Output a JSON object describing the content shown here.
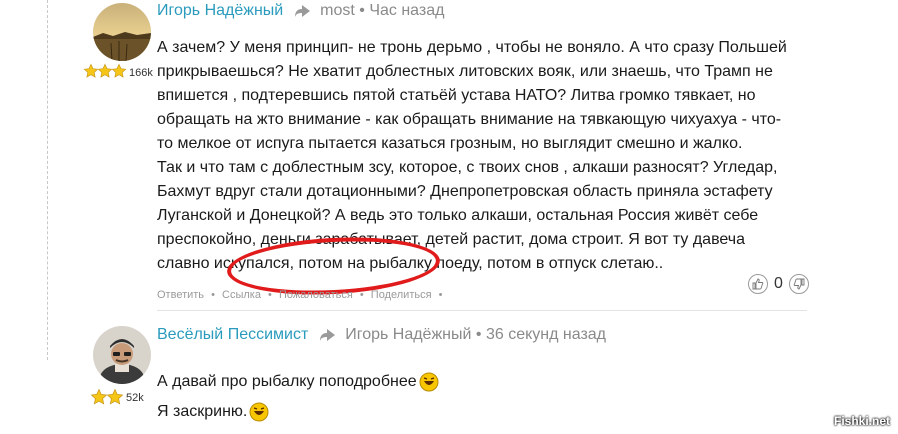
{
  "comments": [
    {
      "author": "Игорь Надёжный",
      "reply_to": "most",
      "separator": "•",
      "time": "Час назад",
      "rating": "166k",
      "paragraphs": [
        "А зачем? У меня принцип- не тронь дерьмо , чтобы не воняло. А что сразу Польшей прикрываешься? Не хватит доблестных литовских вояк, или знаешь, что Трамп не впишется , подтеревшись пятой статьёй устава НАТО? Литва громко тявкает, но обращать на жто внимание - как обращать внимание на тявкающую чихуахуа - что-то мелкое от испуга пытается казаться грозным, но выглядит смешно и жалко.",
        "Так и что там с доблестным зсу, которое, с твоих снов , алкаши разносят? Угледар, Бахмут вдруг стали дотационными? Днепропетровская область приняла эстафету Луганской и Донецкой? А ведь это только алкаши, остальная Россия живёт себе преспокойно, деньги зарабатывает, детей растит, дома строит. Я вот ту давеча славно искупался, потом на рыбалку поеду, потом в отпуск слетаю.."
      ],
      "actions": [
        "Ответить",
        "•",
        "Ссылка",
        "•",
        "Пожаловаться",
        "•",
        "Поделиться",
        "•"
      ],
      "votes": "0"
    },
    {
      "author": "Весёлый Пессимист",
      "reply_to": "Игорь Надёжный",
      "separator": "•",
      "time": "36 секунд назад",
      "rating": "52k",
      "paragraphs": [
        "А давай про рыбалку поподробнее",
        "Я заскриню."
      ]
    }
  ],
  "watermark": "Fishki.net",
  "colors": {
    "username": "#2a9bbd",
    "meta": "#8a8a8a",
    "highlight": "#e11b1b",
    "star": "#f5c518"
  }
}
